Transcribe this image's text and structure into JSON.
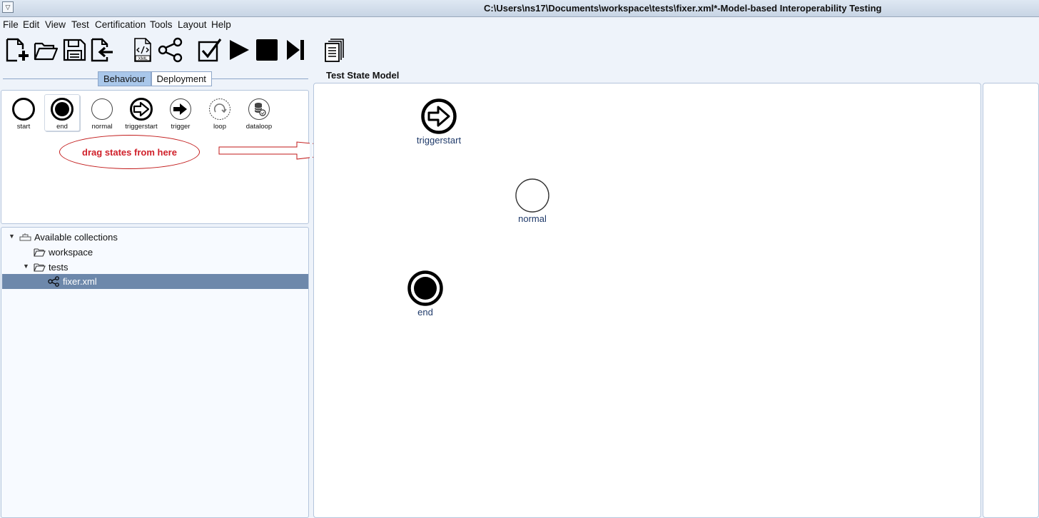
{
  "window": {
    "title": "C:\\Users\\ns17\\Documents\\workspace\\tests\\fixer.xml*-Model-based Interoperability Testing"
  },
  "menu": [
    "File",
    "Edit",
    "View",
    "Test",
    "Certification",
    "Tools",
    "Layout",
    "Help"
  ],
  "toolbar": {
    "buttons": [
      "new-file-icon",
      "open-folder-icon",
      "save-icon",
      "import-icon",
      "xml-file-icon",
      "share-graph-icon",
      "validate-check-icon",
      "play-icon",
      "stop-icon",
      "step-forward-icon",
      "copy-pages-icon"
    ],
    "xml_label": "XML"
  },
  "tabs": {
    "behaviour": "Behaviour",
    "deployment": "Deployment",
    "active": "Behaviour"
  },
  "palette": {
    "items": [
      "start",
      "end",
      "normal",
      "triggerstart",
      "trigger",
      "loop",
      "dataloop"
    ],
    "selected": "end",
    "hint": "drag states from here"
  },
  "tree": {
    "root": "Available collections",
    "workspace": "workspace",
    "tests": "tests",
    "file": "fixer.xml"
  },
  "canvas": {
    "title": "Test State Model",
    "nodes": [
      {
        "type": "triggerstart",
        "label": "triggerstart"
      },
      {
        "type": "normal",
        "label": "normal"
      },
      {
        "type": "end",
        "label": "end"
      }
    ]
  },
  "colors": {
    "accent": "#a9c7ea",
    "selection": "#6d88ab",
    "hint_red": "#d0202a",
    "node_label": "#1f3a6a"
  }
}
